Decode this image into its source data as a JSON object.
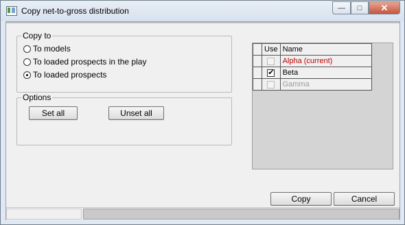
{
  "window": {
    "title": "Copy net-to-gross distribution",
    "buttons": {
      "minimize": "—",
      "maximize": "□",
      "close": "✕"
    }
  },
  "copy_to": {
    "legend": "Copy to",
    "options": [
      {
        "label": "To models",
        "selected": false
      },
      {
        "label": "To loaded prospects in the play",
        "selected": false
      },
      {
        "label": "To loaded prospects",
        "selected": true
      }
    ]
  },
  "options_group": {
    "legend": "Options",
    "set_all": "Set all",
    "unset_all": "Unset all"
  },
  "grid": {
    "headers": {
      "use": "Use",
      "name": "Name"
    },
    "rows": [
      {
        "name": "Alpha   (current)",
        "checked": false,
        "state": "current",
        "color": "#c00000"
      },
      {
        "name": "Beta",
        "checked": true,
        "state": "normal",
        "color": "#000000"
      },
      {
        "name": "Gamma",
        "checked": false,
        "state": "disabled",
        "color": "#9a9a9a"
      }
    ]
  },
  "footer": {
    "copy": "Copy",
    "cancel": "Cancel"
  }
}
